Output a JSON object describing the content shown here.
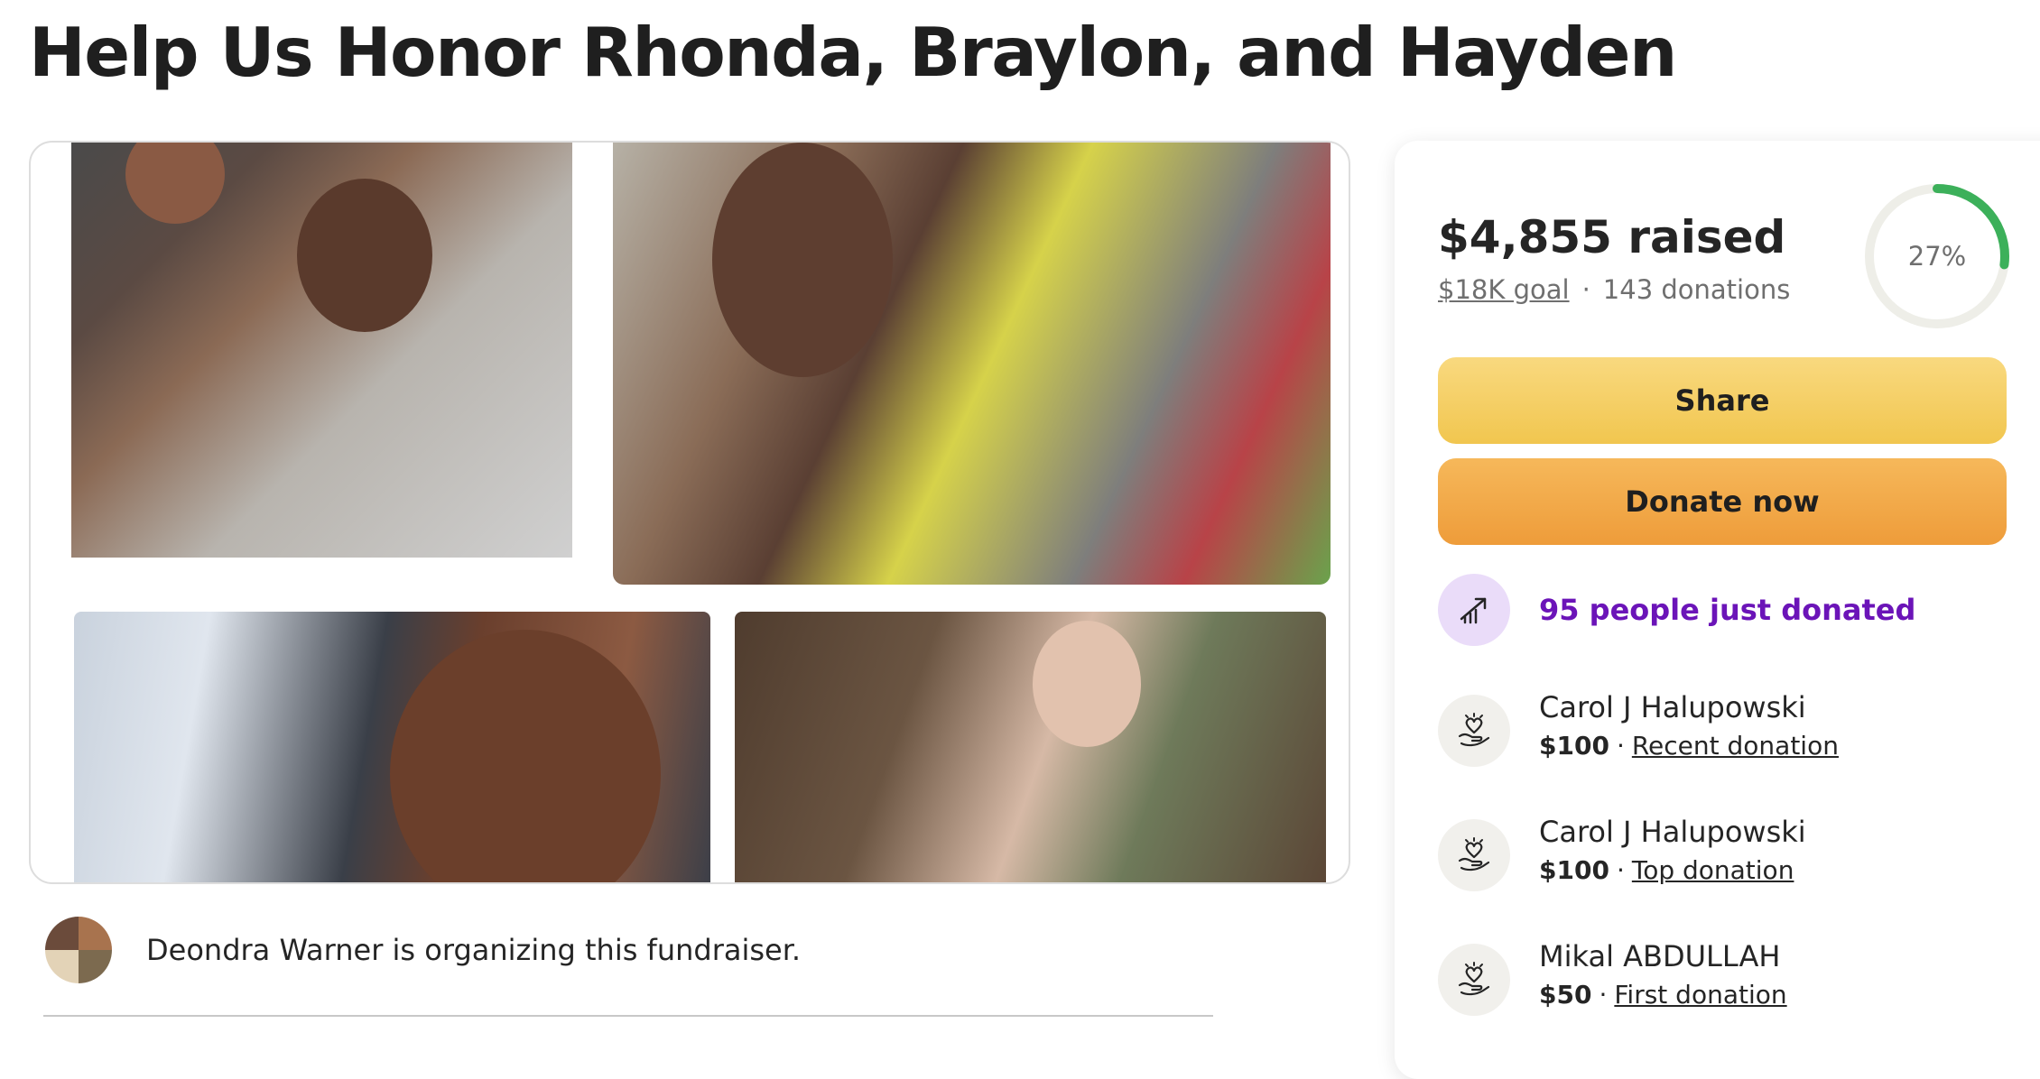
{
  "page": {
    "title": "Help Us Honor Rhonda, Braylon, and Hayden"
  },
  "organizer": {
    "text": "Deondra Warner is organizing this fundraiser."
  },
  "progress": {
    "raised": "$4,855 raised",
    "goal": "$18K goal",
    "separator": "·",
    "donations": "143 donations",
    "percent_label": "27%",
    "percent_value": 0.27
  },
  "buttons": {
    "share": "Share",
    "donate": "Donate now"
  },
  "trending": {
    "text": "95 people just donated"
  },
  "donations": [
    {
      "name": "Carol J Halupowski",
      "amount": "$100",
      "tag": "Recent donation"
    },
    {
      "name": "Carol J Halupowski",
      "amount": "$100",
      "tag": "Top donation"
    },
    {
      "name": "Mikal ABDULLAH",
      "amount": "$50",
      "tag": "First donation"
    }
  ],
  "colors": {
    "accent_green": "#3cb05a",
    "trending_purple": "#6b14b8",
    "share_yellow": "#f3c95a",
    "donate_orange": "#f0a040"
  },
  "icons": {
    "trend": "trending-up-icon",
    "donation": "heart-in-hand-icon"
  }
}
